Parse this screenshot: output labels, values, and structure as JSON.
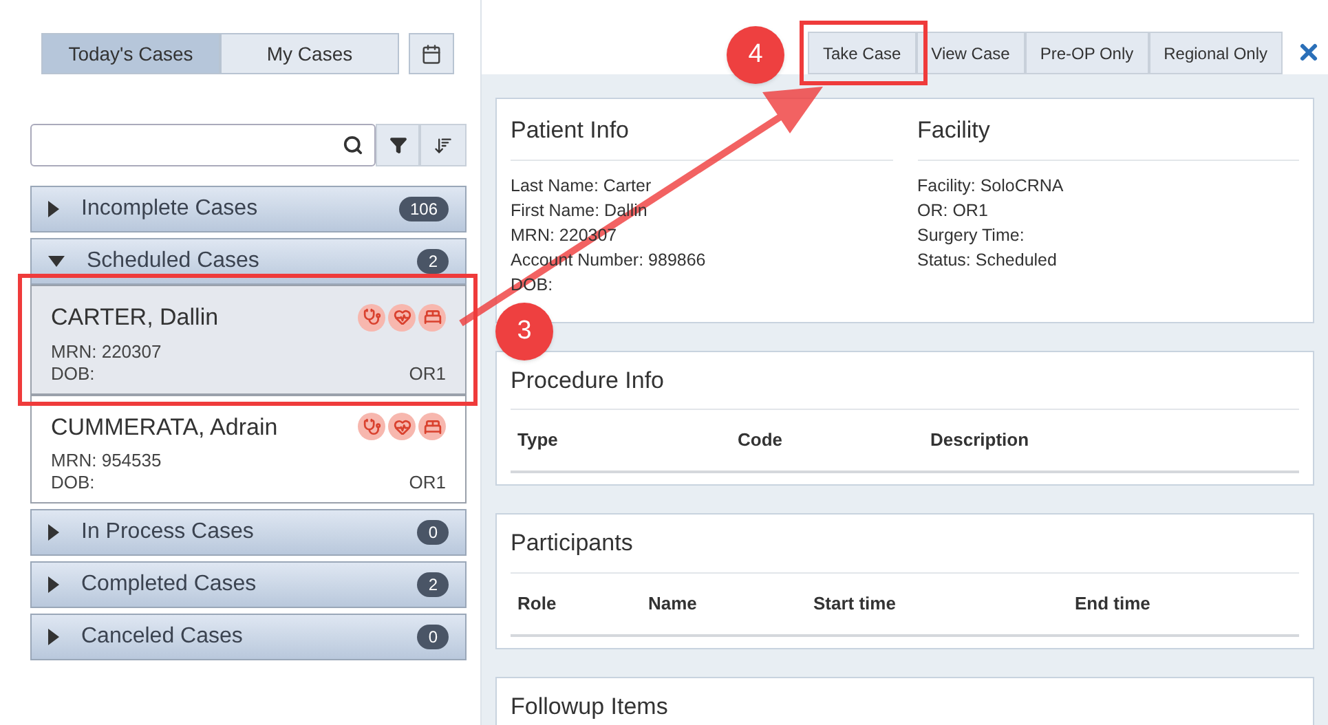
{
  "view_tabs": [
    {
      "label": "Today's Cases",
      "selected": true
    },
    {
      "label": "My Cases",
      "selected": false
    }
  ],
  "groups": [
    {
      "label": "Incomplete Cases",
      "count": "106",
      "expanded": false
    },
    {
      "label": "Scheduled Cases",
      "count": "2",
      "expanded": true,
      "cases": [
        {
          "name": "CARTER, Dallin",
          "mrn_label": "MRN:",
          "mrn": "220307",
          "dob_label": "DOB:",
          "room": "OR1",
          "selected": true
        },
        {
          "name": "CUMMERATA, Adrain",
          "mrn_label": "MRN:",
          "mrn": "954535",
          "dob_label": "DOB:",
          "room": "OR1",
          "selected": false
        }
      ]
    },
    {
      "label": "In Process Cases",
      "count": "0",
      "expanded": false
    },
    {
      "label": "Completed Cases",
      "count": "2",
      "expanded": false
    },
    {
      "label": "Canceled Cases",
      "count": "0",
      "expanded": false
    }
  ],
  "actions": [
    "Take Case",
    "View Case",
    "Pre-OP Only",
    "Regional Only"
  ],
  "patient_info": {
    "title": "Patient Info",
    "lines": [
      "Last Name: Carter",
      "First Name: Dallin",
      "MRN: 220307",
      "Account Number: 989866",
      "DOB:"
    ]
  },
  "facility": {
    "title": "Facility",
    "lines": [
      "Facility: SoloCRNA",
      "OR: OR1",
      "Surgery Time:",
      "Status: Scheduled"
    ]
  },
  "procedure_info": {
    "title": "Procedure Info",
    "columns": [
      "Type",
      "Code",
      "Description"
    ]
  },
  "participants": {
    "title": "Participants",
    "columns": [
      "Role",
      "Name",
      "Start time",
      "End time"
    ]
  },
  "followup": {
    "title": "Followup Items"
  },
  "callouts": [
    "4",
    "3"
  ]
}
